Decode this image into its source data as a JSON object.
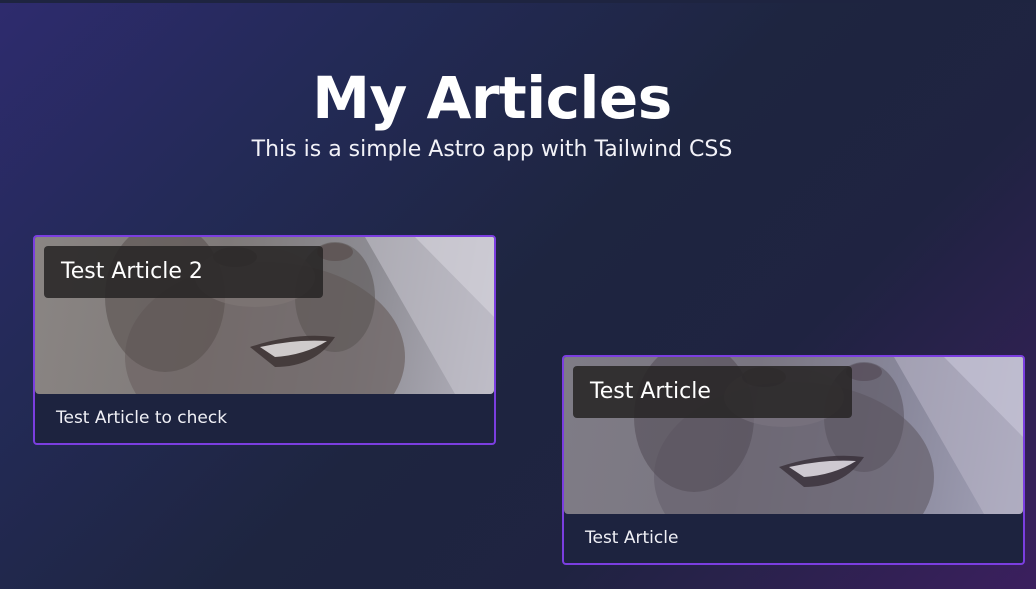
{
  "header": {
    "title": "My Articles",
    "subtitle": "This is a simple Astro app with Tailwind CSS"
  },
  "articles": [
    {
      "title": "Test Article 2",
      "description": "Test Article to check"
    },
    {
      "title": "Test Article",
      "description": "Test Article"
    }
  ],
  "colors": {
    "card_border": "#7b3ee0",
    "background_start": "#2e2b6e",
    "background_end": "#3b1f5e"
  }
}
